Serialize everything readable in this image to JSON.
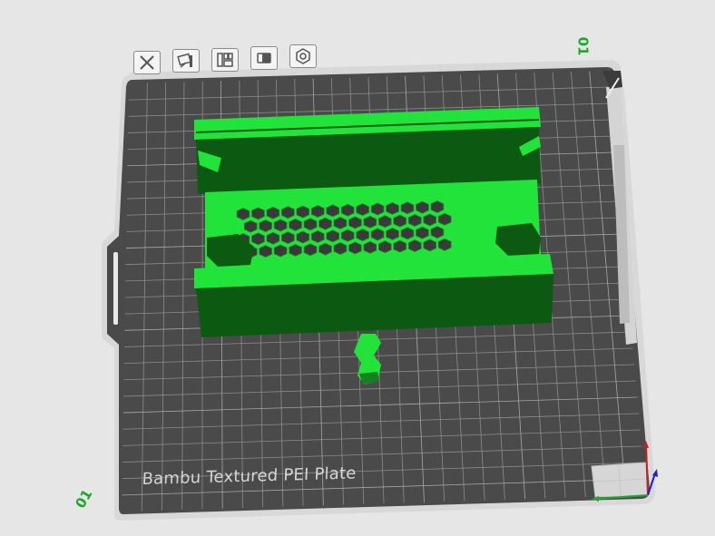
{
  "app": {
    "plate_name": "Bambu Textured PEI Plate",
    "plate_number_top": "01",
    "plate_number_bottom": "01"
  },
  "toolbar": {
    "buttons": [
      {
        "id": "close",
        "icon": "close-icon"
      },
      {
        "id": "arrange",
        "icon": "arrange-icon"
      },
      {
        "id": "layout",
        "icon": "grid-layout-icon"
      },
      {
        "id": "lock",
        "icon": "lock-icon"
      },
      {
        "id": "settings",
        "icon": "gear-icon"
      }
    ]
  },
  "colors": {
    "background": "#e6e6e6",
    "plate": "#4a4a4a",
    "plate_edge": "#d8d8d8",
    "grid": "#8c8c8c",
    "model_bright": "#22e33a",
    "model_dark": "#0c5a12",
    "plate_number": "#1aa82a",
    "axis_x": "#2020c8",
    "axis_y": "#c81e1e",
    "axis_z": "#1aa82a"
  }
}
